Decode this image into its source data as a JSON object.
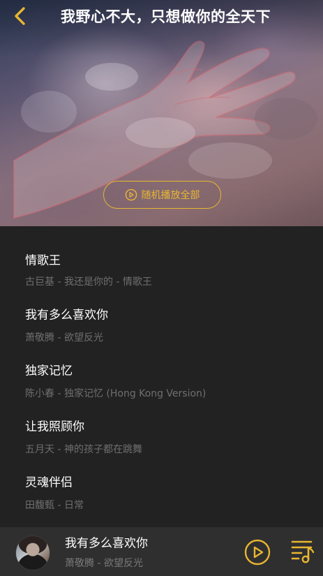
{
  "header": {
    "title": "我野心不大，只想做你的全天下",
    "back_icon": "chevron-left-icon"
  },
  "hero": {
    "shuffle_label": "随机播放全部",
    "shuffle_icon": "play-circle-icon"
  },
  "songs": [
    {
      "name": "情歌王",
      "meta": "古巨基 - 我还是你的 - 情歌王"
    },
    {
      "name": "我有多么喜欢你",
      "meta": "萧敬腾 - 欲望反光"
    },
    {
      "name": "独家记忆",
      "meta": "陈小春 - 独家记忆 (Hong Kong Version)"
    },
    {
      "name": "让我照顾你",
      "meta": "五月天 - 神的孩子都在跳舞"
    },
    {
      "name": "灵魂伴侣",
      "meta": "田馥甄 - 日常"
    }
  ],
  "player": {
    "title": "我有多么喜欢你",
    "artist": "萧敬腾 - 欲望反光",
    "play_icon": "play-circle-icon",
    "playlist_icon": "playlist-music-icon"
  },
  "colors": {
    "accent": "#e9b632",
    "background": "#222222",
    "player_bar": "#2f2f2f",
    "secondary_text": "#6f6f6f"
  }
}
